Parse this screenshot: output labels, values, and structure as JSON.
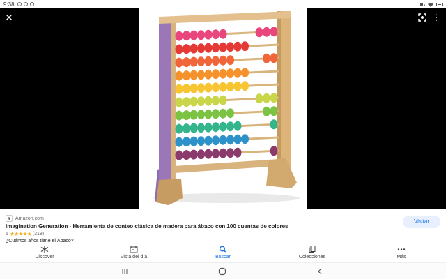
{
  "status": {
    "time": "9:38"
  },
  "viewer": {
    "close_icon": "close-icon",
    "lens_icon": "lens-icon",
    "more_icon": "more-vert-icon"
  },
  "result": {
    "source": "Amazon.com",
    "source_icon": "a",
    "title": "Imagination Generation - Herramienta de conteo clásica de madera para ábaco con 100 cuentas de colores",
    "rating_value": "5",
    "stars": "★★★★★",
    "rating_count": "(318)",
    "related": "¿Cuántos años tiene el Ábaco?",
    "visit_label": "Visitar"
  },
  "nav": {
    "items": [
      {
        "label": "Discover",
        "icon": "asterisk-icon",
        "active": false
      },
      {
        "label": "Vista del día",
        "icon": "today-icon",
        "active": false
      },
      {
        "label": "Buscar",
        "icon": "search-icon",
        "active": true
      },
      {
        "label": "Colecciones",
        "icon": "collections-icon",
        "active": false
      },
      {
        "label": "Más",
        "icon": "more-horiz-icon",
        "active": false
      }
    ]
  },
  "colors": {
    "accent": "#1a73e8",
    "star": "#f2a80e",
    "bead_rows": [
      "#e8467c",
      "#e53935",
      "#f0653a",
      "#f6922b",
      "#f7c531",
      "#c9d64a",
      "#7cc243",
      "#35b58c",
      "#2d92c8",
      "#8a3a6b"
    ]
  }
}
